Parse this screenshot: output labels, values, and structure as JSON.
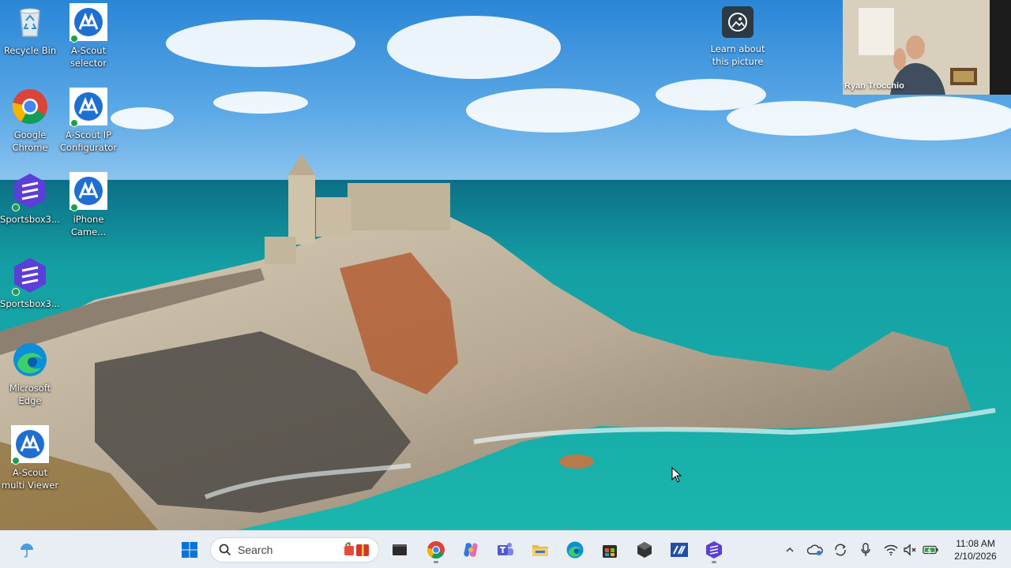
{
  "desktop": {
    "icons": [
      {
        "label": "Recycle Bin"
      },
      {
        "label": "A-Scout selector"
      },
      {
        "label": "Google Chrome"
      },
      {
        "label": "A-Scout IP Configurator"
      },
      {
        "label": "Sportsbox3..."
      },
      {
        "label": "iPhone Came..."
      },
      {
        "label": "Sportsbox3..."
      },
      {
        "label": "Microsoft Edge"
      },
      {
        "label": "A-Scout multi Viewer"
      }
    ],
    "learn_picture": {
      "label": "Learn about this picture"
    }
  },
  "video_call": {
    "participant_name": "Ryan Trocchio"
  },
  "taskbar": {
    "search_label": "Search",
    "pinned_apps": [
      "start-icon",
      "search",
      "file-explorer-app",
      "chrome",
      "copilot",
      "teams",
      "file-explorer",
      "edge",
      "microsoft-store",
      "unity",
      "ascout",
      "sportsbox"
    ],
    "clock": {
      "time": "11:08 AM",
      "date": "2/10/2026"
    }
  },
  "colors": {
    "sky": "#3b8fd6",
    "sea": "#17a3a0",
    "taskbar": "#e9eef4",
    "accent": "#0067c0"
  }
}
